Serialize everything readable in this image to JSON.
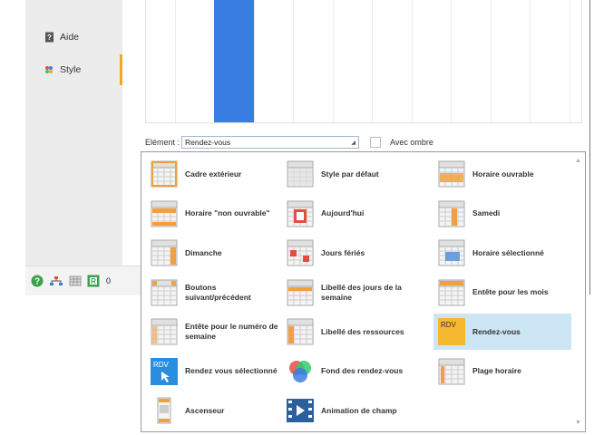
{
  "sidebar": {
    "items": [
      {
        "label": "Aide",
        "icon": "help-book-icon"
      },
      {
        "label": "Style",
        "icon": "style-palette-icon"
      }
    ]
  },
  "bottombar": {
    "icons": [
      "help-circle-icon",
      "network-icon",
      "grid-icon",
      "r-icon"
    ],
    "count": "0"
  },
  "element_row": {
    "label": "Elément :",
    "selected": "Rendez-vous",
    "shadow_label": "Avec ombre"
  },
  "options": [
    {
      "label": "Cadre extérieur",
      "icon": "calendar-frame-icon"
    },
    {
      "label": "Style par défaut",
      "icon": "calendar-default-icon"
    },
    {
      "label": "Horaire ouvrable",
      "icon": "calendar-workhours-icon"
    },
    {
      "label": "Horaire \"non ouvrable\"",
      "icon": "calendar-nonwork-icon"
    },
    {
      "label": "Aujourd'hui",
      "icon": "calendar-today-icon"
    },
    {
      "label": "Samedi",
      "icon": "calendar-saturday-icon"
    },
    {
      "label": "Dimanche",
      "icon": "calendar-sunday-icon"
    },
    {
      "label": "Jours fériés",
      "icon": "calendar-holidays-icon"
    },
    {
      "label": "Horaire sélectionné",
      "icon": "calendar-selected-icon"
    },
    {
      "label": "Boutons suivant/précédent",
      "icon": "calendar-navbuttons-icon"
    },
    {
      "label": "Libellé des jours de la semaine",
      "icon": "calendar-weekdays-icon"
    },
    {
      "label": "Entête pour les mois",
      "icon": "calendar-monthheader-icon"
    },
    {
      "label": "Entête pour le numéro de semaine",
      "icon": "calendar-weeknumber-icon"
    },
    {
      "label": "Libellé des ressources",
      "icon": "calendar-resources-icon"
    },
    {
      "label": "Rendez-vous",
      "icon": "rdv-icon"
    },
    {
      "label": "Rendez vous sélectionné",
      "icon": "rdv-selected-icon"
    },
    {
      "label": "Fond des rendez-vous",
      "icon": "color-circles-icon"
    },
    {
      "label": "Plage horaire",
      "icon": "calendar-timeslot-icon"
    },
    {
      "label": "Ascenseur",
      "icon": "scrollbar-icon"
    },
    {
      "label": "Animation de champ",
      "icon": "animation-icon"
    }
  ],
  "selected_option": "Rendez-vous",
  "colors": {
    "accent": "#f4a82a",
    "preview_bar": "#3a7de2",
    "selection": "#cde6f5",
    "rdv_yellow": "#f5b82e"
  }
}
